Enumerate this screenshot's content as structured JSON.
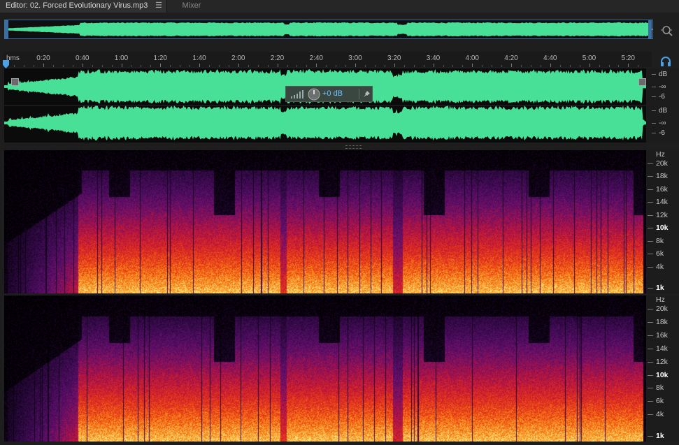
{
  "tabs": {
    "editor_label": "Editor: 02. Forced Evolutionary Virus.mp3",
    "menu_glyph": "☰",
    "mixer_label": "Mixer"
  },
  "ruler": {
    "unit": "hms",
    "labels": [
      "0:20",
      "0:40",
      "1:00",
      "1:20",
      "1:40",
      "2:00",
      "2:20",
      "2:40",
      "3:00",
      "3:20",
      "3:40",
      "4:00",
      "4:20",
      "4:40",
      "5:00",
      "5:20"
    ],
    "total_seconds": 331
  },
  "db_scale": {
    "unit": "dB",
    "neg_inf": "-∞",
    "minus6": "-6"
  },
  "hud": {
    "gain": "+0 dB"
  },
  "hz_scale": {
    "unit": "Hz",
    "labels": [
      "20k",
      "18k",
      "16k",
      "14k",
      "12k",
      "10k",
      "8k",
      "6k",
      "4k",
      "1k"
    ],
    "bold": [
      "10k",
      "1k"
    ]
  },
  "colors": {
    "waveform": "#48e097",
    "selection_border": "#3b6fa3",
    "accent_blue": "#4aa3e8"
  },
  "icons": {
    "zoom": "zoom-icon",
    "headphones": "headphones-icon",
    "playhead": "playhead-icon",
    "pin": "pin-icon",
    "gain_knob": "gain-knob-icon"
  }
}
